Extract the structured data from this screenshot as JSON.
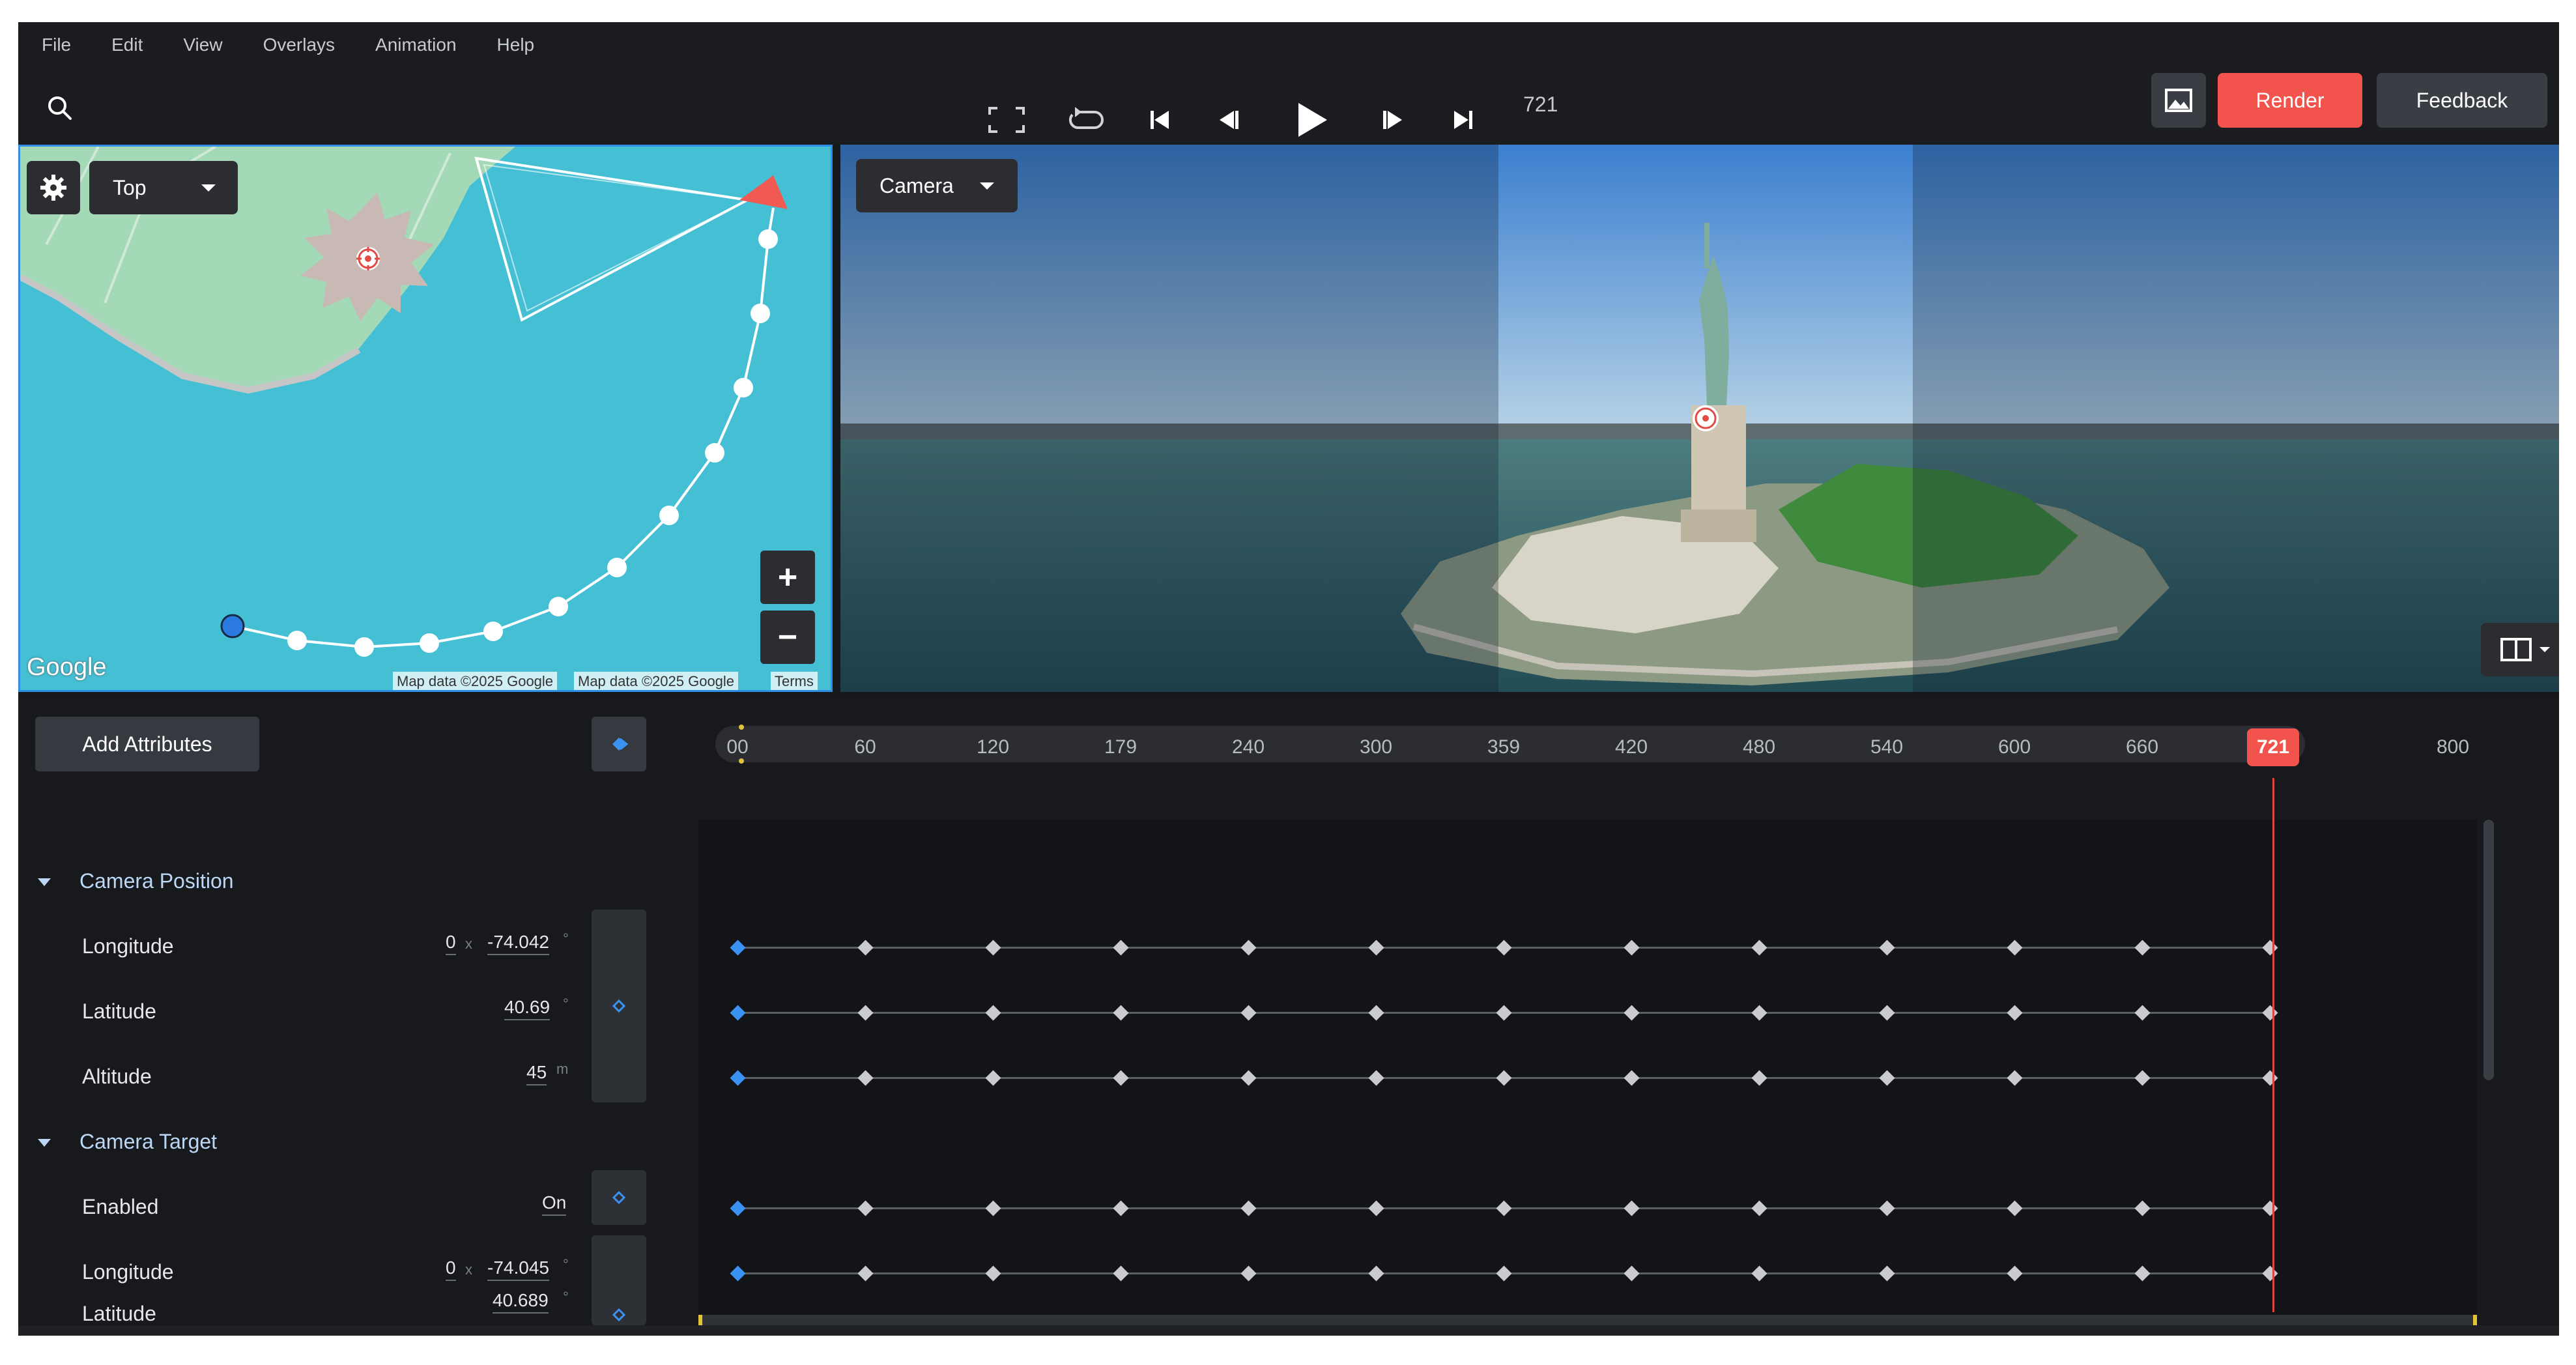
{
  "menu": [
    "File",
    "Edit",
    "View",
    "Overlays",
    "Animation",
    "Help"
  ],
  "transport": {
    "frame": "721"
  },
  "toolbar": {
    "render_label": "Render",
    "feedback_label": "Feedback"
  },
  "map": {
    "view_label": "Top",
    "google_logo": "Google",
    "attribution_1": "Map data ©2025 Google",
    "attribution_2": "Map data ©2025 Google",
    "terms": "Terms"
  },
  "camera_view": {
    "label": "Camera"
  },
  "timeline": {
    "add_attributes_label": "Add Attributes",
    "ticks": [
      "00",
      "60",
      "120",
      "179",
      "240",
      "300",
      "359",
      "420",
      "480",
      "540",
      "600",
      "660"
    ],
    "playhead": "721",
    "end": "800"
  },
  "tracks": {
    "camera_position": {
      "label": "Camera Position",
      "longitude": {
        "label": "Longitude",
        "offset": "0",
        "value": "-74.042",
        "unit": "°"
      },
      "latitude": {
        "label": "Latitude",
        "value": "40.69",
        "unit": "°"
      },
      "altitude": {
        "label": "Altitude",
        "value": "45",
        "unit": "m"
      }
    },
    "camera_target": {
      "label": "Camera Target",
      "enabled": {
        "label": "Enabled",
        "value": "On"
      },
      "longitude": {
        "label": "Longitude",
        "offset": "0",
        "value": "-74.045",
        "unit": "°"
      },
      "latitude": {
        "label": "Latitude",
        "value": "40.689",
        "unit": "°"
      }
    }
  },
  "colors": {
    "accent": "#f2544d",
    "keyframe_first": "#3a93f2",
    "water": "#45bfd4",
    "island": "#98d6ae"
  }
}
